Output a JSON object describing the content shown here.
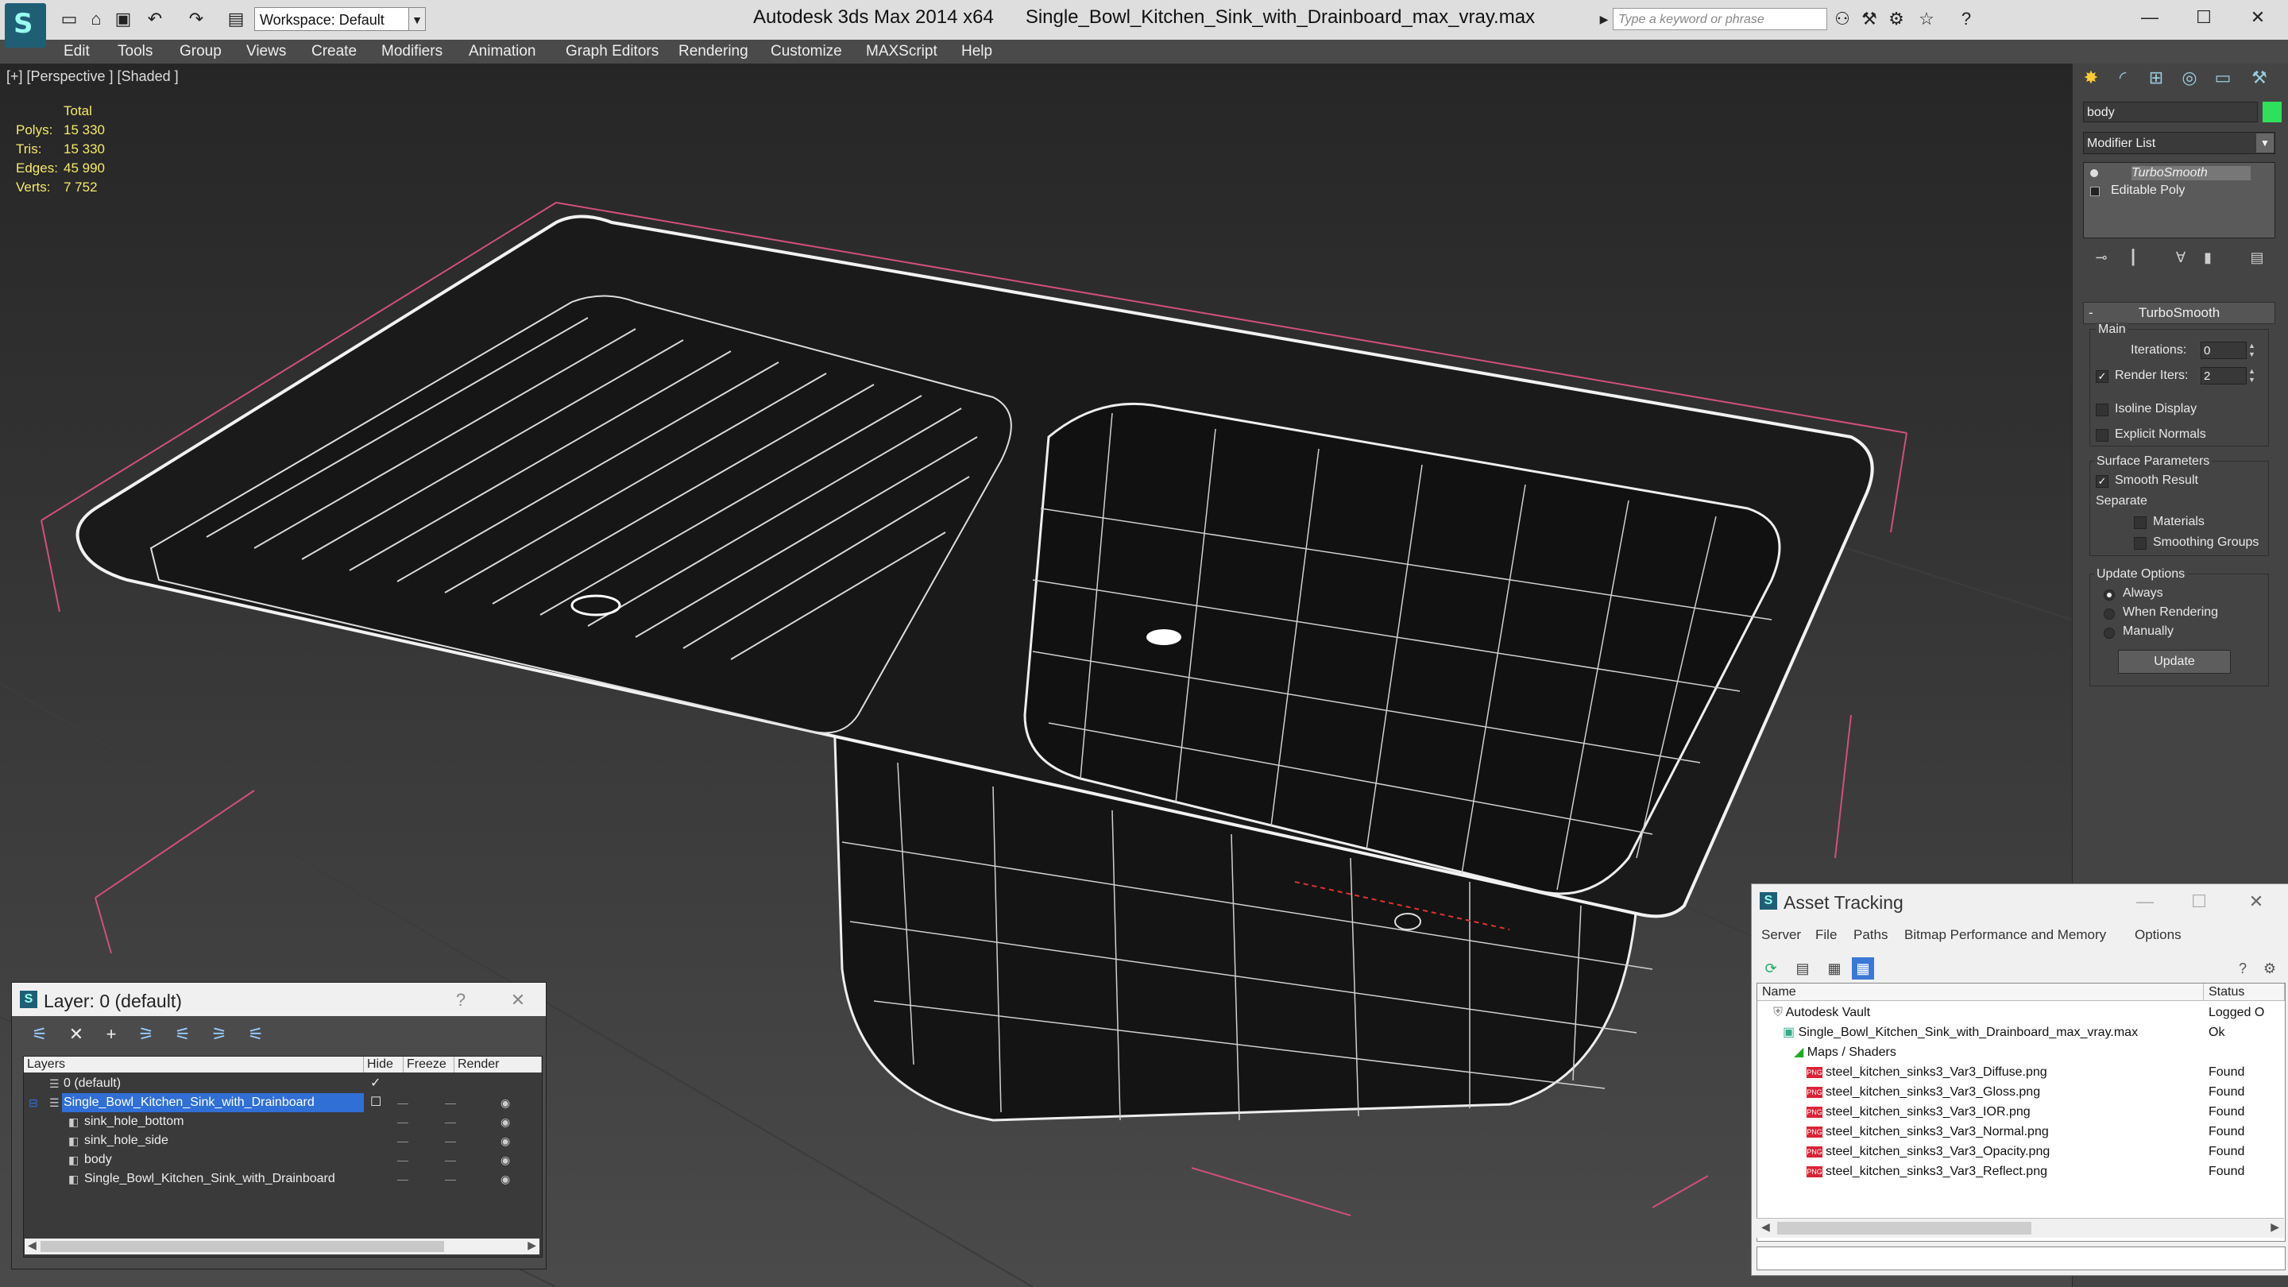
{
  "titlebar": {
    "app_title": "Autodesk 3ds Max  2014 x64",
    "file_title": "Single_Bowl_Kitchen_Sink_with_Drainboard_max_vray.max",
    "workspace": "Workspace: Default",
    "search_placeholder": "Type a keyword or phrase"
  },
  "menu": [
    "Edit",
    "Tools",
    "Group",
    "Views",
    "Create",
    "Modifiers",
    "Animation",
    "Graph Editors",
    "Rendering",
    "Customize",
    "MAXScript",
    "Help"
  ],
  "viewport": {
    "label": "[+] [Perspective ] [Shaded ]",
    "stats": {
      "header": "Total",
      "rows": [
        {
          "label": "Polys:",
          "value": "15 330"
        },
        {
          "label": "Tris:",
          "value": "15 330"
        },
        {
          "label": "Edges:",
          "value": "45 990"
        },
        {
          "label": "Verts:",
          "value": "7 752"
        }
      ]
    }
  },
  "command_panel": {
    "object_name": "body",
    "object_color": "#2ee05a",
    "modifier_list": "Modifier List",
    "stack": [
      "TurboSmooth",
      "Editable Poly"
    ],
    "rollout_title": "TurboSmooth",
    "main_label": "Main",
    "iterations_label": "Iterations:",
    "iterations_value": "0",
    "render_iters_label": "Render Iters:",
    "render_iters_value": "2",
    "render_iters_checked": true,
    "isoline_label": "Isoline Display",
    "explicit_normals_label": "Explicit Normals",
    "surface_params_label": "Surface Parameters",
    "smooth_result_label": "Smooth Result",
    "separate_label": "Separate",
    "materials_label": "Materials",
    "smoothing_groups_label": "Smoothing Groups",
    "update_options_label": "Update Options",
    "update_options": [
      "Always",
      "When Rendering",
      "Manually"
    ],
    "update_selected": "Always",
    "update_button": "Update"
  },
  "layer_dialog": {
    "title": "Layer: 0 (default)",
    "help": "?",
    "columns": [
      "Layers",
      "Hide",
      "Freeze",
      "Render"
    ],
    "rows": [
      {
        "name": "0 (default)",
        "indent": 1,
        "selected": false
      },
      {
        "name": "Single_Bowl_Kitchen_Sink_with_Drainboard",
        "indent": 1,
        "selected": true
      },
      {
        "name": "sink_hole_bottom",
        "indent": 2,
        "selected": false
      },
      {
        "name": "sink_hole_side",
        "indent": 2,
        "selected": false
      },
      {
        "name": "body",
        "indent": 2,
        "selected": false
      },
      {
        "name": "Single_Bowl_Kitchen_Sink_with_Drainboard",
        "indent": 2,
        "selected": false
      }
    ]
  },
  "asset_tracking": {
    "title": "Asset Tracking",
    "menu": [
      "Server",
      "File",
      "Paths",
      "Bitmap Performance and Memory",
      "Options"
    ],
    "columns": [
      "Name",
      "Status"
    ],
    "rows": [
      {
        "name": "Autodesk Vault",
        "status": "Logged O",
        "indent": 0,
        "kind": "vault"
      },
      {
        "name": "Single_Bowl_Kitchen_Sink_with_Drainboard_max_vray.max",
        "status": "Ok",
        "indent": 1,
        "kind": "max"
      },
      {
        "name": "Maps / Shaders",
        "status": "",
        "indent": 2,
        "kind": "folder"
      },
      {
        "name": "steel_kitchen_sinks3_Var3_Diffuse.png",
        "status": "Found",
        "indent": 3,
        "kind": "png"
      },
      {
        "name": "steel_kitchen_sinks3_Var3_Gloss.png",
        "status": "Found",
        "indent": 3,
        "kind": "png"
      },
      {
        "name": "steel_kitchen_sinks3_Var3_IOR.png",
        "status": "Found",
        "indent": 3,
        "kind": "png"
      },
      {
        "name": "steel_kitchen_sinks3_Var3_Normal.png",
        "status": "Found",
        "indent": 3,
        "kind": "png"
      },
      {
        "name": "steel_kitchen_sinks3_Var3_Opacity.png",
        "status": "Found",
        "indent": 3,
        "kind": "png"
      },
      {
        "name": "steel_kitchen_sinks3_Var3_Reflect.png",
        "status": "Found",
        "indent": 3,
        "kind": "png"
      }
    ]
  }
}
